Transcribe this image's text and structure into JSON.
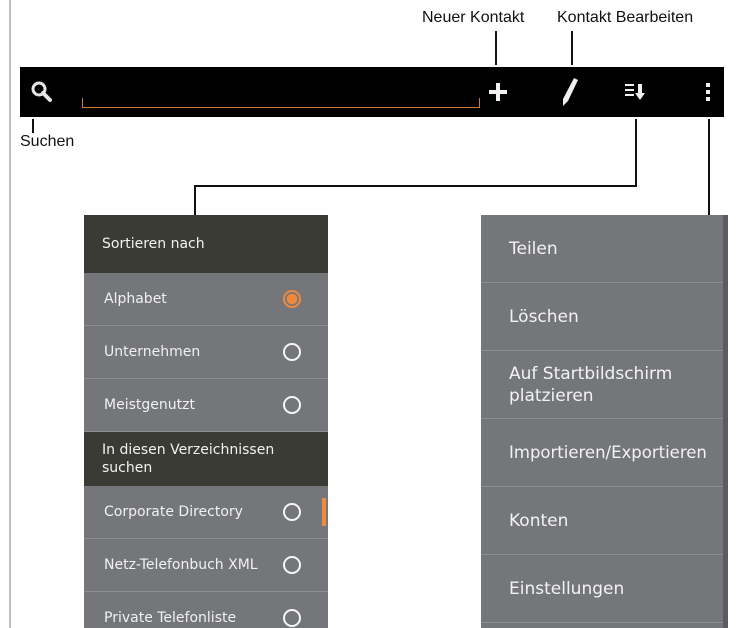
{
  "callouts": {
    "new_contact": "Neuer Kontakt",
    "edit_contact": "Kontakt Bearbeiten",
    "search": "Suchen"
  },
  "toolbar": {
    "search_icon": "search-icon",
    "add_icon": "plus-icon",
    "edit_icon": "pencil-icon",
    "sort_icon": "sort-icon",
    "overflow_icon": "more-vertical-icon",
    "accent_color": "#c77b3b"
  },
  "sort_menu": {
    "header": "Sortieren nach",
    "options": [
      {
        "label": "Alphabet",
        "selected": true
      },
      {
        "label": "Unternehmen",
        "selected": false
      },
      {
        "label": "Meistgenutzt",
        "selected": false
      }
    ],
    "directory_header": "In diesen Verzeichnissen suchen",
    "directories": [
      {
        "label": "Corporate Directory",
        "selected": false
      },
      {
        "label": "Netz-Telefonbuch XML",
        "selected": false
      },
      {
        "label": "Private Telefonliste",
        "selected": false
      }
    ],
    "selected_color": "#f08a3a"
  },
  "overflow_menu": {
    "items": [
      "Teilen",
      "Löschen",
      "Auf Startbildschirm platzieren",
      "Importieren/Exportieren",
      "Konten",
      "Einstellungen"
    ]
  }
}
